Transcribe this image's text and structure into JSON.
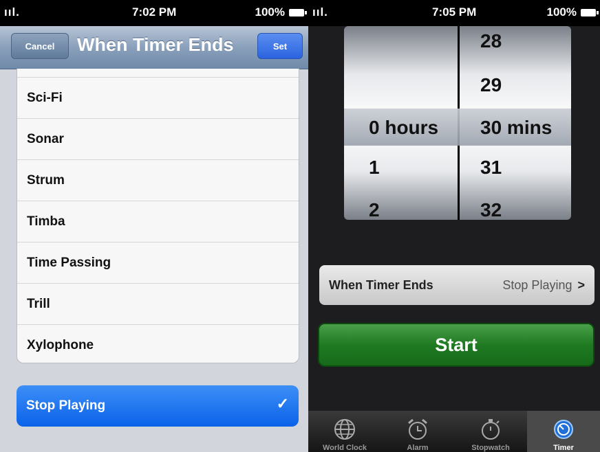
{
  "left": {
    "status": {
      "signal": "ııl.",
      "time": "7:02 PM",
      "battery": "100%"
    },
    "navbar": {
      "cancel": "Cancel",
      "title": "When Timer Ends",
      "set": "Set"
    },
    "sounds": [
      "Sci-Fi",
      "Sonar",
      "Strum",
      "Timba",
      "Time Passing",
      "Trill",
      "Xylophone"
    ],
    "selected": {
      "label": "Stop Playing",
      "check": "✓"
    }
  },
  "right": {
    "status": {
      "signal": "ııl.",
      "time": "7:05 PM",
      "battery": "100%"
    },
    "picker": {
      "hours": [
        "0 hours",
        "1",
        "2"
      ],
      "minutes": [
        "28",
        "29",
        "30 mins",
        "31",
        "32"
      ]
    },
    "when_timer_ends": {
      "label": "When Timer Ends",
      "value": "Stop Playing",
      "chevron": ">"
    },
    "start": "Start",
    "tabs": [
      "World Clock",
      "Alarm",
      "Stopwatch",
      "Timer"
    ],
    "active_tab": "Timer",
    "colors": {
      "accent_blue": "#0a62e8",
      "start_green": "#1f7a22"
    }
  }
}
